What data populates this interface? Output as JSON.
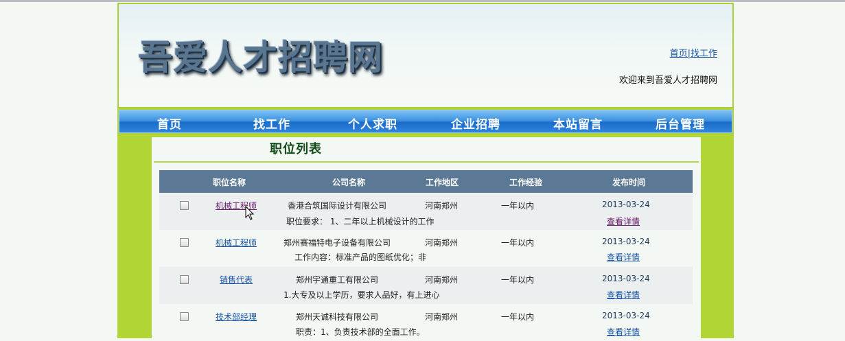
{
  "header": {
    "logo_text": "吾爱人才招聘网",
    "links": {
      "home": "首页",
      "separator": "|",
      "find_job": "找工作"
    },
    "welcome": "欢迎来到吾爱人才招聘网"
  },
  "nav": {
    "items": [
      "首页",
      "找工作",
      "个人求职",
      "企业招聘",
      "本站留言",
      "后台管理"
    ]
  },
  "main": {
    "title": "职位列表",
    "columns": [
      "职位名称",
      "公司名称",
      "工作地区",
      "工作经验",
      "发布时间"
    ],
    "rows": [
      {
        "position": "机械工程师",
        "company": "香港合筑国际设计有限公司",
        "region": "河南郑州",
        "experience": "一年以内",
        "date": "2013-03-24",
        "desc": "职位要求： 1、二年以上机械设计的工作",
        "detail": "查看详情"
      },
      {
        "position": "机械工程师",
        "company": "郑州赛福特电子设备有限公司",
        "region": "河南郑州",
        "experience": "一年以内",
        "date": "2013-03-24",
        "desc": "工作内容：标准产品的图纸优化；非",
        "detail": "查看详情"
      },
      {
        "position": "销售代表",
        "company": "郑州宇通重工有限公司",
        "region": "河南郑州",
        "experience": "一年以内",
        "date": "2013-03-24",
        "desc": "1.大专及以上学历，要求人品好，有上进心",
        "detail": "查看详情"
      },
      {
        "position": "技术部经理",
        "company": "郑州天诚科技有限公司",
        "region": "河南郑州",
        "experience": "一年以内",
        "date": "2013-03-24",
        "desc": "职责：1、负责技术部的全面工作。",
        "detail": "查看详情"
      }
    ]
  },
  "colors": {
    "page_green": "#b1d534",
    "table_header": "#5b7995",
    "nav_blue": "#2f86e0",
    "link_blue": "#1a54a4",
    "visited_purple": "#6b1a6b"
  }
}
